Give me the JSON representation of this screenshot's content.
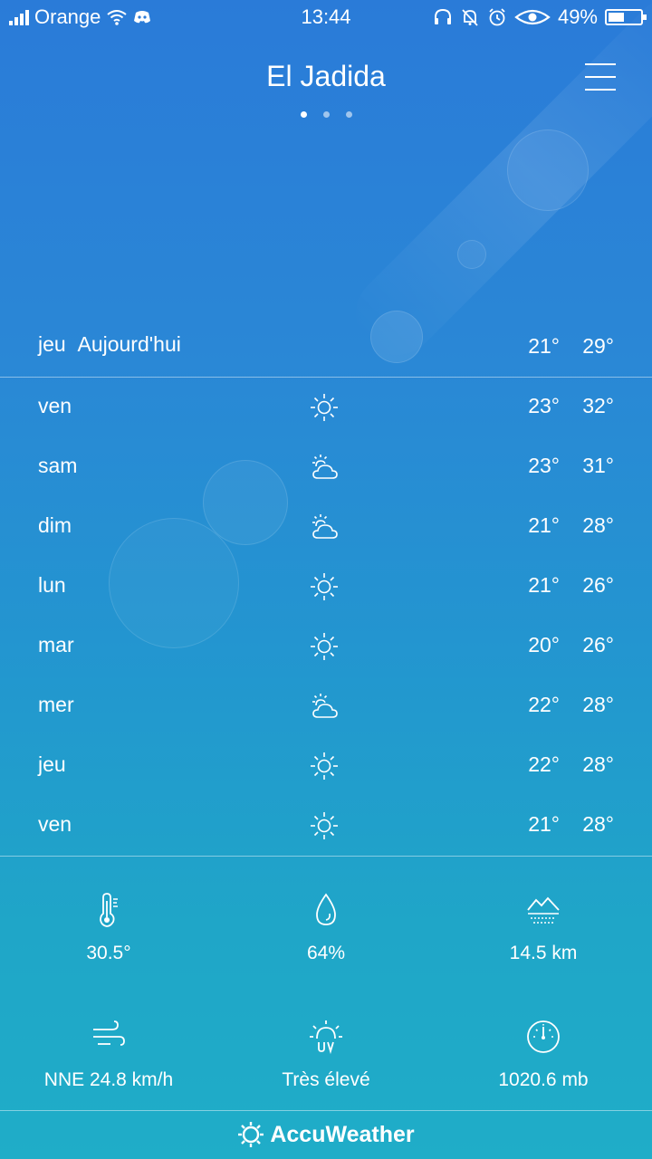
{
  "status_bar": {
    "carrier": "Orange",
    "time": "13:44",
    "battery_percent": "49%",
    "battery_level": 0.49,
    "icons": [
      "signal-icon",
      "wifi-icon",
      "discord-icon",
      "headset-icon",
      "bell-off-icon",
      "alarm-icon",
      "eye-icon",
      "battery-icon"
    ]
  },
  "header": {
    "city": "El Jadida",
    "page_count": 3,
    "active_page": 0
  },
  "today": {
    "day": "jeu",
    "label": "Aujourd'hui",
    "min": "21°",
    "max": "29°"
  },
  "forecast": [
    {
      "day": "ven",
      "icon": "sun",
      "min": "23°",
      "max": "32°"
    },
    {
      "day": "sam",
      "icon": "partly-cloudy",
      "min": "23°",
      "max": "31°"
    },
    {
      "day": "dim",
      "icon": "partly-cloudy",
      "min": "21°",
      "max": "28°"
    },
    {
      "day": "lun",
      "icon": "sun",
      "min": "21°",
      "max": "26°"
    },
    {
      "day": "mar",
      "icon": "sun",
      "min": "20°",
      "max": "26°"
    },
    {
      "day": "mer",
      "icon": "partly-cloudy",
      "min": "22°",
      "max": "28°"
    },
    {
      "day": "jeu",
      "icon": "sun",
      "min": "22°",
      "max": "28°"
    },
    {
      "day": "ven",
      "icon": "sun",
      "min": "21°",
      "max": "28°"
    }
  ],
  "details": {
    "feels_like": "30.5°",
    "humidity": "64%",
    "visibility": "14.5 km",
    "wind": "NNE 24.8 km/h",
    "uv": "Très élevé",
    "pressure": "1020.6 mb"
  },
  "footer": {
    "brand": "AccuWeather"
  }
}
